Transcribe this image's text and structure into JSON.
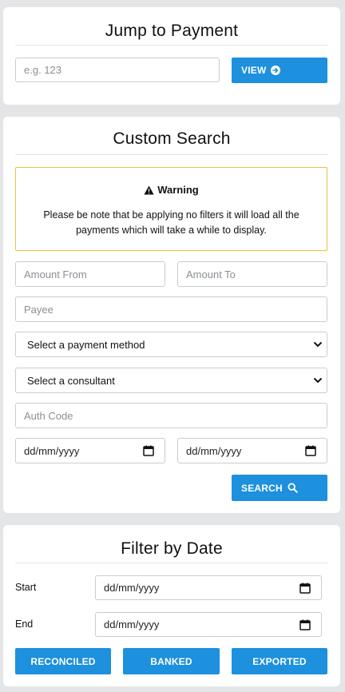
{
  "jump": {
    "title": "Jump to Payment",
    "placeholder": "e.g. 123",
    "view_label": "VIEW"
  },
  "custom": {
    "title": "Custom Search",
    "warning_title": "Warning",
    "warning_text": "Please be note that be applying no filters it will load all the payments which will take a while to display.",
    "amount_from": "Amount From",
    "amount_to": "Amount To",
    "payee": "Payee",
    "payment_method": "Select a payment method",
    "consultant": "Select a consultant",
    "auth_code": "Auth Code",
    "date_from": "dd/mm/yyyy",
    "date_to": "dd/mm/yyyy",
    "search_label": "SEARCH"
  },
  "filter": {
    "title": "Filter by Date",
    "start_label": "Start",
    "end_label": "End",
    "start_value": "dd/mm/yyyy",
    "end_value": "dd/mm/yyyy",
    "reconciled_label": "RECONCILED",
    "banked_label": "BANKED",
    "exported_label": "EXPORTED"
  },
  "colors": {
    "accent": "#1d90de",
    "warning_border": "#e8c23e",
    "background": "#e4e5e6"
  },
  "icons": {
    "view": "arrow-circle-right-icon",
    "search": "search-icon",
    "warning": "warning-triangle-icon",
    "select": "chevron-down-icon",
    "date": "calendar-icon"
  }
}
